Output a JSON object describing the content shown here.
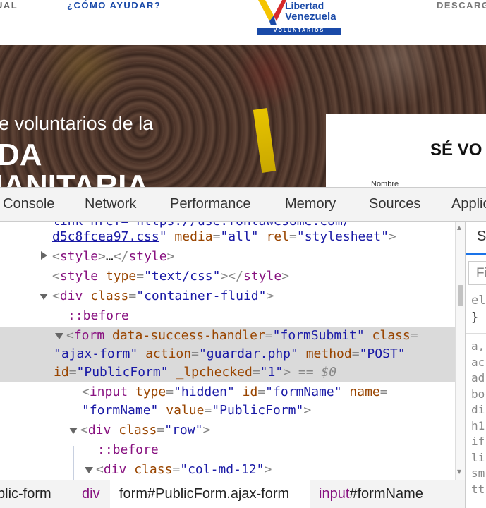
{
  "site": {
    "nav_manual": "UAL",
    "nav_help": "¿CÓMO AYUDAR?",
    "nav_download": "DESCARG",
    "logo_line1": "Libertad",
    "logo_line2": "Venezuela",
    "logo_band": "VOLUNTARIOS",
    "hero_line1": "e voluntarios de la",
    "hero_line2": "DA",
    "hero_line3": "IANITARIA",
    "form_title": "SÉ VO",
    "form_label": "Nombre"
  },
  "devtools": {
    "tabs": [
      "Console",
      "Network",
      "Performance",
      "Memory",
      "Sources",
      "Applic"
    ],
    "styles_tab": "S",
    "styles_filter_placeholder": "Fi",
    "styles_rule": [
      "el",
      "}"
    ],
    "styles_list": [
      "a,",
      "ac",
      "ad",
      "bo",
      "di",
      "h1",
      "if",
      "li",
      "sm",
      "tt"
    ],
    "elements": {
      "l0": {
        "partial": "link href=\"https://use.fontawesome.com/"
      },
      "l1": {
        "href_tail": "d5c8fcea97.css",
        "attr_media": "media",
        "val_media": "all",
        "attr_rel": "rel",
        "val_rel": "stylesheet"
      },
      "l2": {
        "tag": "style",
        "ellipsis": "…"
      },
      "l3": {
        "tag": "style",
        "attr_type": "type",
        "val_type": "text/css"
      },
      "l4": {
        "tag": "div",
        "attr_class": "class",
        "val_class": "container-fluid"
      },
      "l5": {
        "pseudo": "::before"
      },
      "l6": {
        "tag": "form",
        "attr1": "data-success-handler",
        "val1": "formSubmit",
        "attr2": "class"
      },
      "l7": {
        "val2": "ajax-form",
        "attr3": "action",
        "val3": "guardar.php",
        "attr4": "method",
        "val4": "POST"
      },
      "l8": {
        "attr5": "id",
        "val5": "PublicForm",
        "attr6": "_lpchecked",
        "val6": "1",
        "eq": "== $0"
      },
      "l9": {
        "tag": "input",
        "attr_type": "type",
        "val_type": "hidden",
        "attr_id": "id",
        "val_id": "formName",
        "attr_name": "name"
      },
      "l10": {
        "val_name": "formName",
        "attr_value": "value",
        "val_value": "PublicForm"
      },
      "l11": {
        "tag": "div",
        "attr_class": "class",
        "val_class": "row"
      },
      "l12": {
        "pseudo": "::before"
      },
      "l13": {
        "tag": "div",
        "attr_class": "class",
        "val_class": "col-md-12"
      }
    },
    "breadcrumb": {
      "c1": "blic-form",
      "c2": "div",
      "c3": "form#PublicForm.ajax-form",
      "c4_tag": "input",
      "c4_rest": "#formName"
    }
  }
}
